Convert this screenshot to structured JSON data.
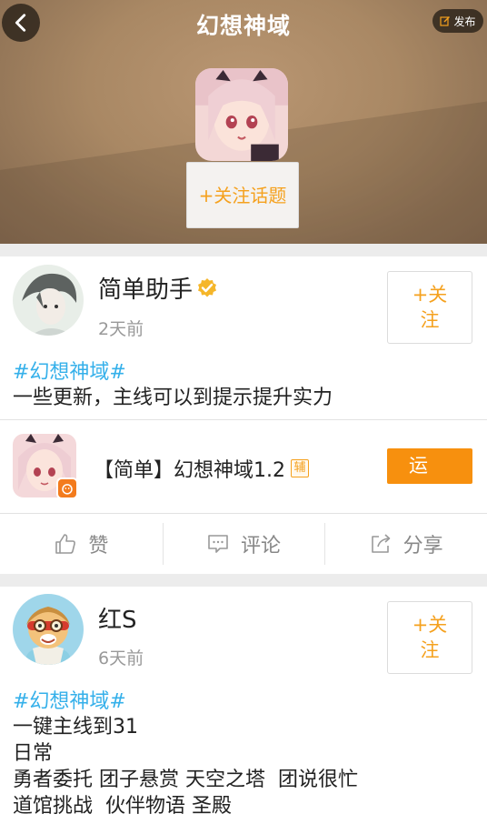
{
  "header": {
    "title": "幻想神域",
    "publish_label": "发布",
    "follow_topic_label": "+关注话题"
  },
  "posts": [
    {
      "username": "简单助手",
      "verified": true,
      "time": "2天前",
      "follow_label": "+关注",
      "hashtag": "#幻想神域#",
      "text": "一些更新，主线可以到提示提升实力",
      "app": {
        "name": "【简单】幻想神域1.2",
        "tag": "辅",
        "run_label": "运"
      },
      "actions": {
        "like": "赞",
        "comment": "评论",
        "share": "分享"
      }
    },
    {
      "username": "红S",
      "time": "6天前",
      "follow_label": "+关注",
      "hashtag": "#幻想神域#",
      "text": "一键主线到31\n日常\n勇者委托 团子悬赏 天空之塔  团说很忙\n道馆挑战  伙伴物语 圣殿"
    }
  ],
  "colors": {
    "accent_orange": "#f5a11e",
    "run_button": "#f7900e",
    "hashtag_blue": "#35b0ea",
    "time_gray": "#999999"
  },
  "icons": [
    "back-arrow-icon",
    "edit-icon",
    "verified-icon",
    "thumbs-up-icon",
    "comment-icon",
    "share-icon"
  ]
}
